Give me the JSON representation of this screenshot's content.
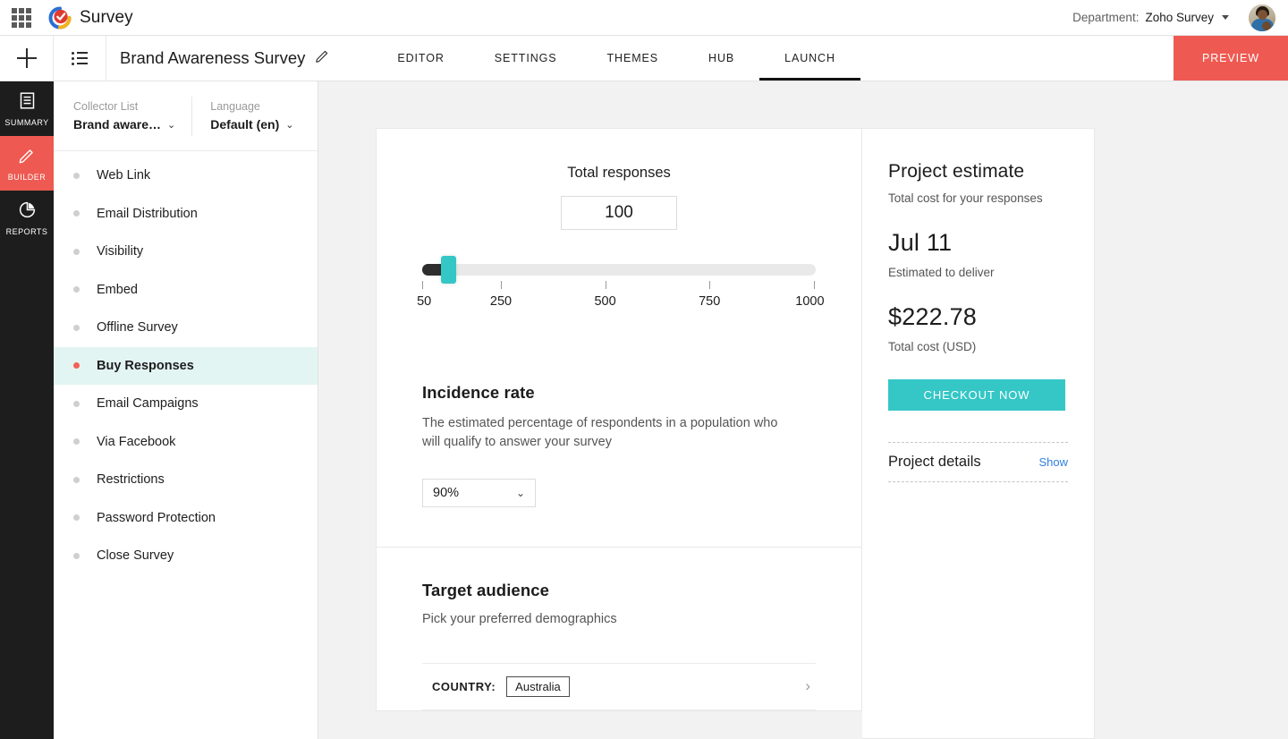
{
  "topbar": {
    "apps_icon": "grid-apps-icon",
    "logo_icon": "zoho-survey-logo",
    "app_name": "Survey",
    "department_label": "Department:",
    "department_value": "Zoho Survey",
    "department_caret_icon": "caret-down-icon",
    "avatar_icon": "user-avatar"
  },
  "subbar": {
    "add_icon": "plus-icon",
    "list_icon": "list-view-icon",
    "survey_title": "Brand Awareness Survey",
    "edit_icon": "pencil-edit-icon",
    "tabs": [
      {
        "label": "EDITOR",
        "active": false
      },
      {
        "label": "SETTINGS",
        "active": false
      },
      {
        "label": "THEMES",
        "active": false
      },
      {
        "label": "HUB",
        "active": false
      },
      {
        "label": "LAUNCH",
        "active": true
      }
    ],
    "preview_label": "PREVIEW"
  },
  "rail": {
    "items": [
      {
        "label": "SUMMARY",
        "icon": "document-icon",
        "active": false
      },
      {
        "label": "BUILDER",
        "icon": "pencil-icon",
        "active": true
      },
      {
        "label": "REPORTS",
        "icon": "pie-chart-icon",
        "active": false
      }
    ]
  },
  "collector": {
    "collector_list_caption": "Collector List",
    "collector_list_value": "Brand aware…",
    "language_caption": "Language",
    "language_value": "Default (en)",
    "chevron_icon": "chevron-down-icon",
    "nav_items": [
      {
        "label": "Web Link",
        "active": false
      },
      {
        "label": "Email Distribution",
        "active": false
      },
      {
        "label": "Visibility",
        "active": false
      },
      {
        "label": "Embed",
        "active": false
      },
      {
        "label": "Offline Survey",
        "active": false
      },
      {
        "label": "Buy Responses",
        "active": true
      },
      {
        "label": "Email Campaigns",
        "active": false
      },
      {
        "label": "Via Facebook",
        "active": false
      },
      {
        "label": "Restrictions",
        "active": false
      },
      {
        "label": "Password Protection",
        "active": false
      },
      {
        "label": "Close Survey",
        "active": false
      }
    ]
  },
  "main": {
    "responses": {
      "title": "Total responses",
      "value": "100",
      "slider": {
        "min": 50,
        "max": 1000,
        "current": 100,
        "ticks": [
          "50",
          "250",
          "500",
          "750",
          "1000"
        ]
      }
    },
    "incidence": {
      "title": "Incidence rate",
      "description": "The estimated percentage of respondents in a population who will qualify to answer your survey",
      "selected": "90%",
      "chevron_icon": "chevron-down-icon"
    },
    "target": {
      "title": "Target audience",
      "description": "Pick your preferred demographics",
      "country_label": "COUNTRY:",
      "country_value": "Australia",
      "chevron_icon": "chevron-right-icon"
    }
  },
  "estimate": {
    "title": "Project estimate",
    "caption": "Total cost for your responses",
    "delivery_date": "Jul 11",
    "delivery_caption": "Estimated to deliver",
    "total_cost": "$222.78",
    "total_cost_caption": "Total cost (USD)",
    "checkout_label": "CHECKOUT NOW",
    "details_label": "Project details",
    "show_label": "Show"
  },
  "colors": {
    "accent_red": "#ee5a52",
    "accent_teal": "#35c6c6",
    "active_row_bg": "#e3f5f2",
    "link_blue": "#2f7fe0",
    "rail_bg": "#1d1d1d"
  }
}
